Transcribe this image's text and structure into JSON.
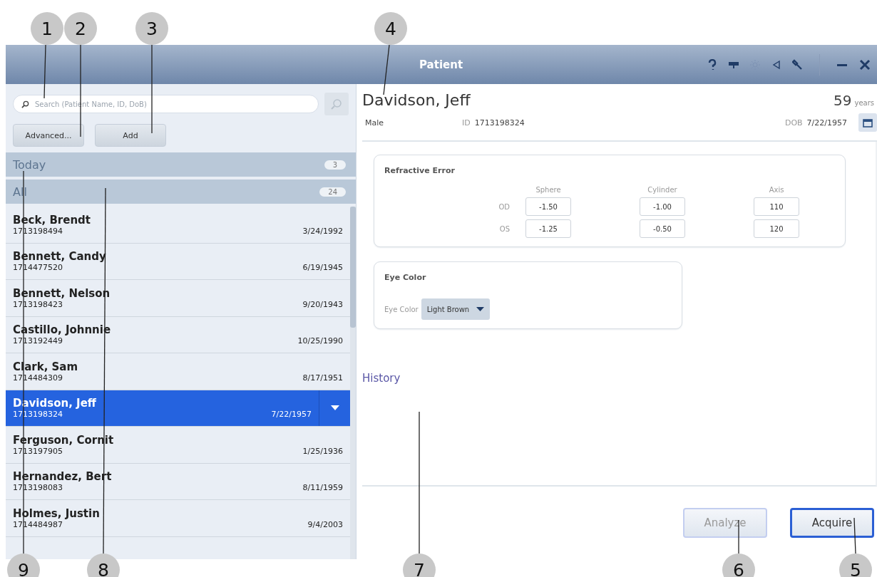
{
  "window": {
    "title": "Patient"
  },
  "search": {
    "placeholder": "Search (Patient Name, ID, DoB)"
  },
  "list_buttons": [
    "Advanced...",
    "Add"
  ],
  "groups": [
    {
      "label": "Today",
      "count": "3"
    },
    {
      "label": "All",
      "count": "24"
    }
  ],
  "patients": [
    {
      "name": "Beck, Brendt",
      "id": "1713198494",
      "dob": "3/24/1992",
      "selected": false
    },
    {
      "name": "Bennett, Candy",
      "id": "1714477520",
      "dob": "6/19/1945",
      "selected": false
    },
    {
      "name": "Bennett, Nelson",
      "id": "1713198423",
      "dob": "9/20/1943",
      "selected": false
    },
    {
      "name": "Castillo, Johnnie",
      "id": "1713192449",
      "dob": "10/25/1990",
      "selected": false
    },
    {
      "name": "Clark, Sam",
      "id": "1714484309",
      "dob": "8/17/1951",
      "selected": false
    },
    {
      "name": "Davidson, Jeff",
      "id": "1713198324",
      "dob": "7/22/1957",
      "selected": true
    },
    {
      "name": "Ferguson, Cornit",
      "id": "1713197905",
      "dob": "1/25/1936",
      "selected": false
    },
    {
      "name": "Hernandez, Bert",
      "id": "1713198083",
      "dob": "8/11/1959",
      "selected": false
    },
    {
      "name": "Holmes, Justin",
      "id": "1714484987",
      "dob": "9/4/2003",
      "selected": false
    }
  ],
  "patient": {
    "name": "Davidson, Jeff",
    "age": "59",
    "age_unit": "years",
    "sex": "Male",
    "id_label": "ID",
    "id": "1713198324",
    "dob_label": "DOB",
    "dob": "7/22/1957"
  },
  "refractive_error": {
    "title": "Refractive Error",
    "columns": [
      "Sphere",
      "Cylinder",
      "Axis"
    ],
    "rows": [
      {
        "eye": "OD",
        "values": [
          "-1.50",
          "-1.00",
          "110"
        ]
      },
      {
        "eye": "OS",
        "values": [
          "-1.25",
          "-0.50",
          "120"
        ]
      }
    ]
  },
  "eye_color": {
    "title": "Eye Color",
    "label": "Eye Color",
    "value": "Light Brown"
  },
  "history": {
    "label": "History"
  },
  "actions": [
    {
      "label": "Analyze",
      "disabled": true,
      "focused": false
    },
    {
      "label": "Acquire",
      "disabled": false,
      "focused": true
    }
  ],
  "callouts": [
    "1",
    "2",
    "3",
    "4",
    "9",
    "8",
    "7",
    "6",
    "5"
  ]
}
